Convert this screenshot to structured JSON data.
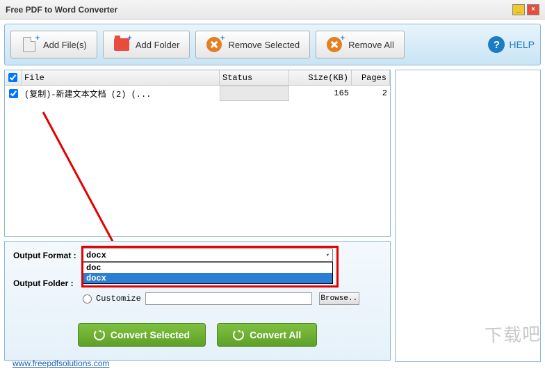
{
  "window": {
    "title": "Free PDF to Word Converter"
  },
  "toolbar": {
    "add_files": "Add File(s)",
    "add_folder": "Add Folder",
    "remove_selected": "Remove Selected",
    "remove_all": "Remove All",
    "help": "HELP"
  },
  "table": {
    "headers": {
      "file": "File",
      "status": "Status",
      "size": "Size(KB)",
      "pages": "Pages"
    },
    "rows": [
      {
        "checked": true,
        "file": "(复制)-新建文本文档 (2) (...",
        "status": "",
        "size": "165",
        "pages": "2"
      }
    ]
  },
  "settings": {
    "output_format_label": "Output Format :",
    "output_folder_label": "Output Folder :",
    "selected_format": "docx",
    "options": [
      "doc",
      "docx"
    ],
    "customize": "Customize",
    "browse": "Browse.."
  },
  "convert": {
    "selected": "Convert Selected",
    "all": "Convert All"
  },
  "footer": {
    "link": "www.freepdfsolutions.com"
  },
  "watermark": "下载吧"
}
